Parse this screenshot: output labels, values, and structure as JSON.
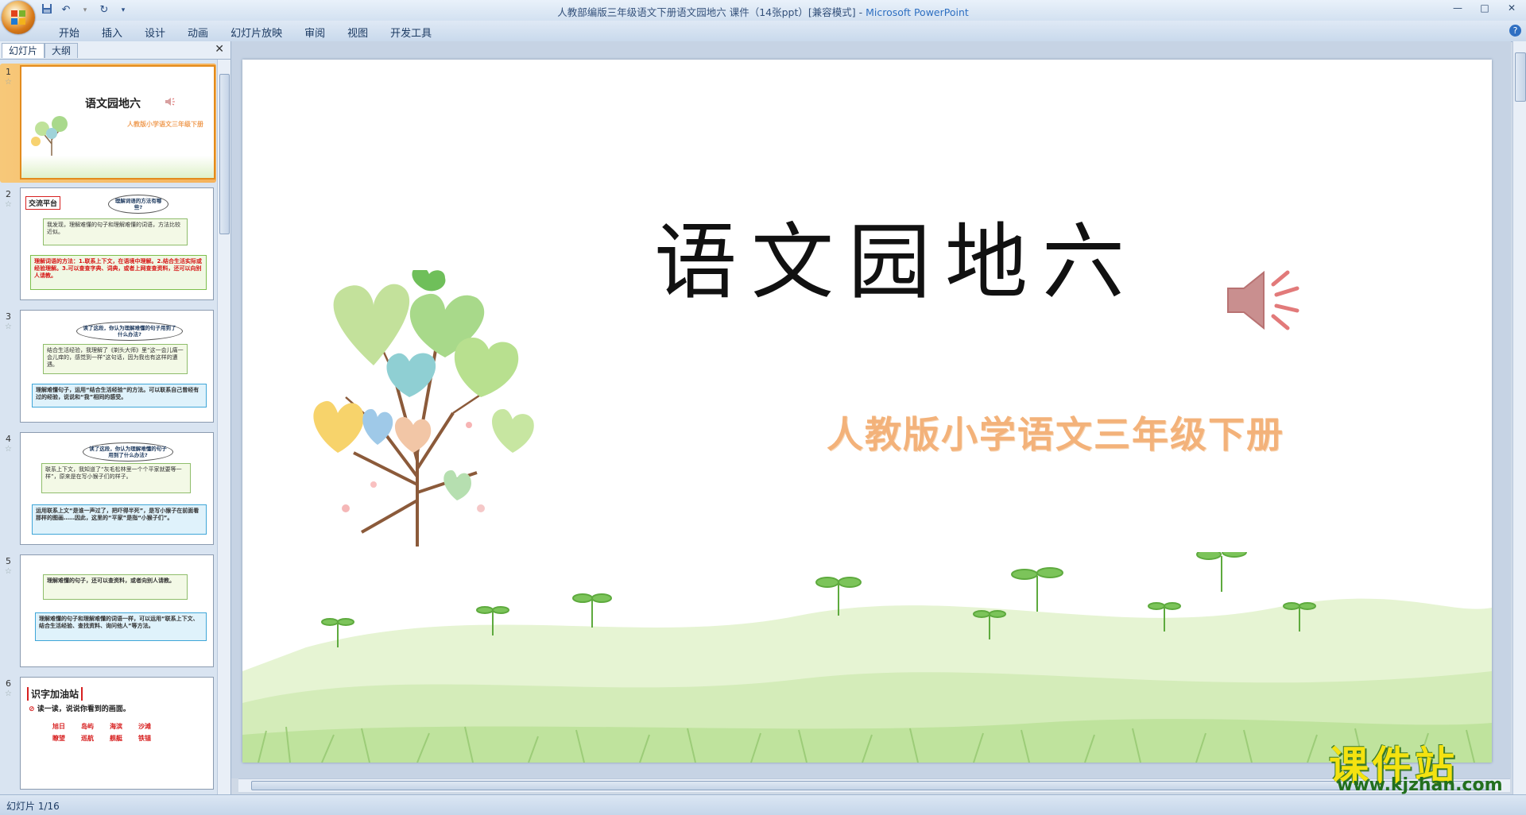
{
  "window": {
    "title": "人教部编版三年级语文下册语文园地六 课件（14张ppt）[兼容模式] - ",
    "app_name": "Microsoft PowerPoint",
    "controls": [
      "—",
      "□",
      "✕"
    ]
  },
  "qat": {
    "save_icon": "save-icon",
    "undo_icon": "undo-icon",
    "redo_icon": "redo-icon",
    "customize_icon": "dropdown-icon"
  },
  "ribbon": {
    "tabs": [
      "开始",
      "插入",
      "设计",
      "动画",
      "幻灯片放映",
      "审阅",
      "视图",
      "开发工具"
    ],
    "help": "?"
  },
  "panel": {
    "tabs": [
      "幻灯片",
      "大纲"
    ],
    "close": "✕"
  },
  "thumbnails": [
    {
      "num": "1",
      "title": "语文园地六",
      "subtitle": "人教版小学语文三年级下册"
    },
    {
      "num": "2",
      "label": "交流平台",
      "cloud": "理解词语的方法有哪些?",
      "text": "我发现，理解难懂的句子和理解难懂的词语，方法比较近似。",
      "red": "理解词语的方法：1.联系上下文，在语境中理解。2.结合生活实际或经验理解。3.可以查查字典、词典，或者上网查查资料，还可以向别人请教。"
    },
    {
      "num": "3",
      "cloud": "读了这段，你认为理解难懂的句子用到了什么办法?",
      "text": "结合生活经验，我理解了《剃头大师》里“这一会儿痛一会儿痒的，感觉到一样”这句话，因为我也有这样的遭遇。",
      "blue": "理解难懂句子，运用“结合生活经验”的方法。可以联系自己曾经有过的经验，说说和“我”相同的感受。"
    },
    {
      "num": "4",
      "cloud": "读了这段，你认为理解难懂的句子用到了什么办法?",
      "text": "联系上下文，我知道了“灰毛松林里一个个平家就要等一样”，原来是在写小猴子们的样子。",
      "blue": "运用联系上文“是谁一声过了，把吓得半死”，是写小猴子在前面看那样的图画……因此，这里的“平家”是指“小猴子们”。"
    },
    {
      "num": "5",
      "text": "理解难懂的句子，还可以查资料，或者向别人请教。",
      "blue": "理解难懂的句子和理解难懂的词语一样，可以运用“联系上下文、结合生活经验、查找资料、询问他人”等方法。"
    },
    {
      "num": "6",
      "title": "识字加油站",
      "instruction": "读一读，说说你看到的画面。",
      "words": [
        "旭日",
        "岛屿",
        "海滨",
        "沙滩",
        "瞭望",
        "巡航",
        "舰艇",
        "铁锚"
      ]
    }
  ],
  "slide": {
    "title": "语文园地六",
    "subtitle": "人教版小学语文三年级下册",
    "sound_icon": "speaker-icon"
  },
  "status": {
    "slide_indicator": "幻灯片 1/16"
  },
  "watermark": {
    "text": "课件站",
    "url": "www.kjzhan.com"
  },
  "colors": {
    "accent": "#2d6fc1",
    "selected_thumb": "#f5b25b",
    "subtitle": "#f3b27a",
    "watermark": "#f4e210"
  }
}
